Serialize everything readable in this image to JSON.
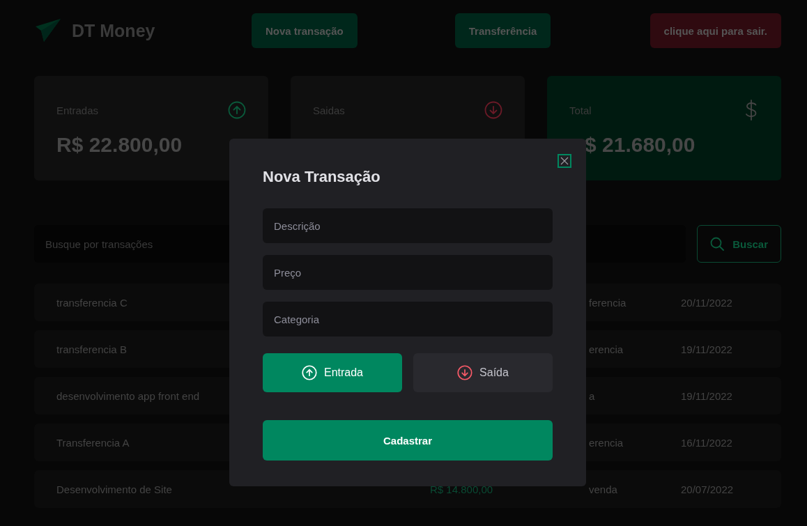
{
  "header": {
    "logo_text": "DT Money",
    "buttons": [
      {
        "label": "Nova transação",
        "kind": "primary"
      },
      {
        "label": "Transferência",
        "kind": "primary"
      },
      {
        "label": "clique aqui para sair.",
        "kind": "danger"
      }
    ]
  },
  "summary": [
    {
      "label": "Entradas",
      "kind": "income",
      "value": "R$ 22.800,00"
    },
    {
      "label": "Saidas",
      "kind": "outcome"
    },
    {
      "label": "Total",
      "kind": "total",
      "value": "$ 21.680,00"
    }
  ],
  "search": {
    "placeholder": "Busque por transações",
    "button": "Buscar"
  },
  "transactions": [
    {
      "description": "transferencia C",
      "category": "ferencia",
      "date": "20/11/2022"
    },
    {
      "description": "transferencia B",
      "category": "erencia",
      "date": "19/11/2022"
    },
    {
      "description": "desenvolvimento app front end",
      "category": "a",
      "date": "19/11/2022"
    },
    {
      "description": "Transferencia A",
      "category": "erencia",
      "date": "16/11/2022"
    },
    {
      "description": "Desenvolvimento de Site",
      "price": "R$ 14.800,00",
      "category": "venda",
      "date": "20/07/2022"
    }
  ],
  "modal": {
    "title": "Nova Transação",
    "fields": [
      {
        "placeholder": "Descrição"
      },
      {
        "placeholder": "Preço"
      },
      {
        "placeholder": "Categoria"
      }
    ],
    "type_options": [
      {
        "label": "Entrada",
        "kind": "income",
        "selected": true
      },
      {
        "label": "Saída",
        "kind": "outcome",
        "selected": false
      }
    ],
    "submit": "Cadastrar"
  }
}
